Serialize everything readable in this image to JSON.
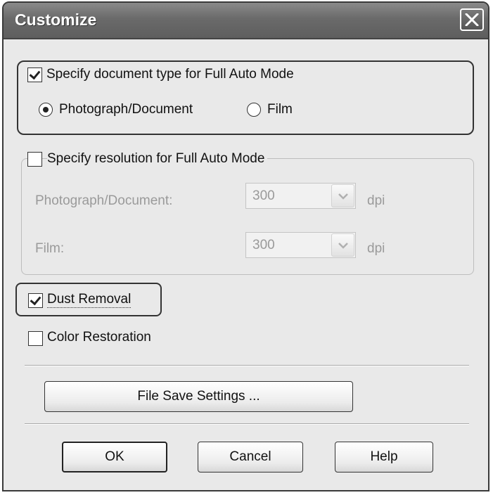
{
  "window": {
    "title": "Customize",
    "close_icon": "close-icon"
  },
  "doc_type_group": {
    "checkbox_label": "Specify document type for Full Auto Mode",
    "checked": true,
    "options": [
      {
        "label": "Photograph/Document",
        "selected": true
      },
      {
        "label": "Film",
        "selected": false
      }
    ]
  },
  "resolution_group": {
    "checkbox_label": "Specify resolution for Full Auto Mode",
    "checked": false,
    "photo_label": "Photograph/Document:",
    "photo_value": "300",
    "film_label": "Film:",
    "film_value": "300",
    "unit": "dpi"
  },
  "dust_removal": {
    "label": "Dust Removal",
    "checked": true
  },
  "color_restoration": {
    "label": "Color Restoration",
    "checked": false
  },
  "buttons": {
    "file_save": "File Save Settings ...",
    "ok": "OK",
    "cancel": "Cancel",
    "help": "Help"
  }
}
